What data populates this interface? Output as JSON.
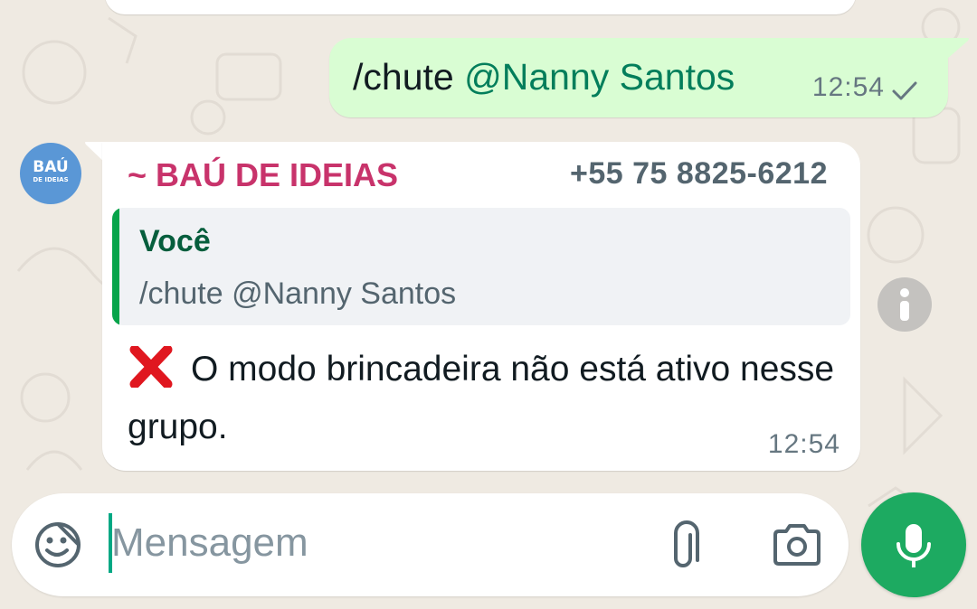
{
  "chat": {
    "outgoing": {
      "command": "/chute",
      "mention": "@Nanny Santos",
      "time": "12:54",
      "status_icon": "single-check-icon"
    },
    "incoming": {
      "avatar_line1": "BAÚ",
      "avatar_line2": "DE IDEIAS",
      "sender_name": "~ BAÚ DE IDEIAS",
      "sender_phone": "+55 75 8825-6212",
      "quote": {
        "author": "Você",
        "text": "/chute @Nanny Santos"
      },
      "emoji_icon": "red-x-icon",
      "text": "O modo brincadeira não está ativo nesse grupo.",
      "time": "12:54"
    },
    "info_icon": "info-icon"
  },
  "composer": {
    "placeholder": "Mensagem",
    "value": "",
    "icons": [
      "sticker-icon",
      "paperclip-icon",
      "camera-icon",
      "microphone-icon"
    ]
  },
  "colors": {
    "background": "#efeae2",
    "outgoing_bubble": "#d9fdd3",
    "incoming_bubble": "#ffffff",
    "mention": "#027e5b",
    "sender_name": "#c8336b",
    "quote_bar": "#06a44a",
    "mic_button": "#1daa61"
  }
}
